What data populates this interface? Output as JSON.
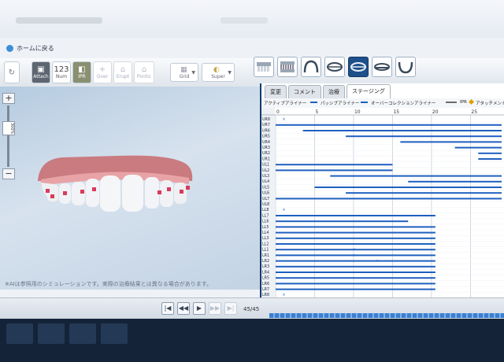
{
  "app": {
    "home_label": "ホームに戻る"
  },
  "toolbar": {
    "buttons": [
      {
        "icon": "refresh-icon",
        "label": ""
      },
      {
        "icon": "attach-icon",
        "label": "Attach"
      },
      {
        "icon": "number-icon",
        "glyph": "123",
        "label": "Num"
      },
      {
        "icon": "ipr-icon",
        "label": "IPR"
      },
      {
        "icon": "overcorrection-icon",
        "label": "Over"
      },
      {
        "icon": "erupt-icon",
        "label": "Erupt"
      },
      {
        "icon": "pontic-icon",
        "label": "Pontic"
      }
    ],
    "grid_label": "Grid",
    "super_label": "Super",
    "views": [
      "front-view",
      "side-view",
      "upper-arch-view",
      "front-bite-view",
      "occlusal-view",
      "lower-bite-view",
      "lower-arch-view"
    ],
    "active_view": "occlusal-view"
  },
  "zoom": {
    "percent_label": "300%"
  },
  "disclaimer": "※AIは参照用のシミュレーションです。実際の治療結果とは異なる場合があります。",
  "panel": {
    "tabs": [
      {
        "label": "変更"
      },
      {
        "label": "コメント"
      },
      {
        "label": "治療"
      },
      {
        "label": "ステージング"
      }
    ],
    "active_tab": "ステージング",
    "legend": [
      {
        "label": "アクティブアライナー",
        "color": "#1f5fbf"
      },
      {
        "label": "パッシブアライナー",
        "color": "#1f5fbf"
      },
      {
        "label": "オーバーコレクションアライナー",
        "color": "#6a6a6a"
      },
      {
        "label": "IPR",
        "color": "#c08a2a"
      },
      {
        "label": "アタッチメント",
        "color": "#e0a000"
      }
    ]
  },
  "chart_data": {
    "type": "gantt",
    "x_ticks": [
      0,
      5,
      10,
      15,
      20,
      25
    ],
    "xlim": [
      0,
      29
    ],
    "rows": [
      {
        "tooth": "UR8",
        "start": null,
        "end": null,
        "marks": [
          1
        ]
      },
      {
        "tooth": "UR7",
        "start": 0,
        "end": 29,
        "marks": []
      },
      {
        "tooth": "UR6",
        "start": 3.5,
        "end": 29,
        "marks": []
      },
      {
        "tooth": "UR5",
        "start": 9,
        "end": 29,
        "marks": []
      },
      {
        "tooth": "UR4",
        "start": 16,
        "end": 29,
        "marks": []
      },
      {
        "tooth": "UR3",
        "start": 23,
        "end": 29,
        "marks": []
      },
      {
        "tooth": "UR2",
        "start": 26,
        "end": 29,
        "marks": []
      },
      {
        "tooth": "UR1",
        "start": 26,
        "end": 29,
        "marks": []
      },
      {
        "tooth": "UL1",
        "start": 0,
        "end": 15,
        "marks": []
      },
      {
        "tooth": "UL2",
        "start": 0,
        "end": 15,
        "marks": []
      },
      {
        "tooth": "UL3",
        "start": 7,
        "end": 29,
        "marks": []
      },
      {
        "tooth": "UL4",
        "start": 17,
        "end": 29,
        "marks": []
      },
      {
        "tooth": "UL5",
        "start": 5,
        "end": 29,
        "marks": []
      },
      {
        "tooth": "UL6",
        "start": 9,
        "end": 29,
        "marks": []
      },
      {
        "tooth": "UL7",
        "start": 0,
        "end": 29,
        "marks": []
      },
      {
        "tooth": "UL8",
        "start": null,
        "end": null,
        "marks": []
      },
      {
        "tooth": "LL8",
        "start": null,
        "end": null,
        "marks": [
          1
        ]
      },
      {
        "tooth": "LL7",
        "start": 0,
        "end": 20.5,
        "marks": []
      },
      {
        "tooth": "LL6",
        "start": 0,
        "end": 17,
        "marks": []
      },
      {
        "tooth": "LL5",
        "start": 0,
        "end": 20.5,
        "marks": []
      },
      {
        "tooth": "LL4",
        "start": 0,
        "end": 20.5,
        "marks": []
      },
      {
        "tooth": "LL3",
        "start": 0,
        "end": 20.5,
        "marks": []
      },
      {
        "tooth": "LL2",
        "start": 0,
        "end": 20.5,
        "marks": []
      },
      {
        "tooth": "LL1",
        "start": 0,
        "end": 20.5,
        "marks": [
          10
        ]
      },
      {
        "tooth": "LR1",
        "start": 0,
        "end": 20.5,
        "marks": [
          10
        ]
      },
      {
        "tooth": "LR2",
        "start": 0,
        "end": 20.5,
        "marks": [
          13
        ]
      },
      {
        "tooth": "LR3",
        "start": 0,
        "end": 20.5,
        "marks": []
      },
      {
        "tooth": "LR4",
        "start": 0,
        "end": 20.5,
        "marks": []
      },
      {
        "tooth": "LR5",
        "start": 0,
        "end": 20.5,
        "marks": []
      },
      {
        "tooth": "LR6",
        "start": 0,
        "end": 20.5,
        "marks": []
      },
      {
        "tooth": "LR7",
        "start": 0,
        "end": 20.5,
        "marks": []
      },
      {
        "tooth": "LR8",
        "start": null,
        "end": null,
        "marks": [
          1
        ]
      }
    ]
  },
  "navigation": {
    "frame_label": "45/45",
    "current_stage": 45,
    "total_stages": 45,
    "progress": 1
  }
}
